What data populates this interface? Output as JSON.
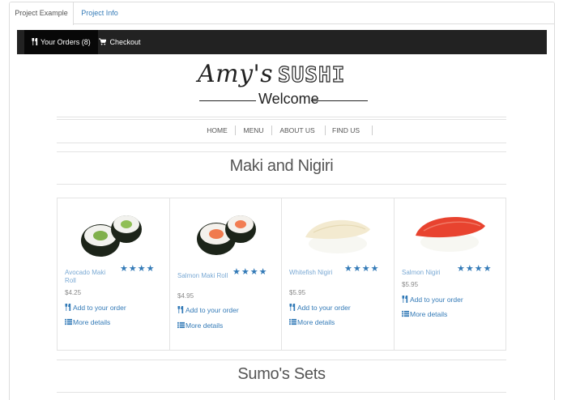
{
  "tabs": [
    {
      "label": "Project Example"
    },
    {
      "label": "Project Info"
    }
  ],
  "navbar": {
    "orders_label": "Your Orders (8)",
    "checkout_label": "Checkout"
  },
  "logo": {
    "name": "Amy's",
    "brand": "SUSHI",
    "tagline": "Welcome"
  },
  "menu": {
    "items": [
      {
        "label": "HOME"
      },
      {
        "label": "MENU"
      },
      {
        "label": "ABOUT US"
      },
      {
        "label": "FIND US"
      }
    ]
  },
  "sections": [
    {
      "title": "Maki and Nigiri"
    },
    {
      "title": "Sumo's Sets"
    }
  ],
  "products": [
    {
      "name": "Avocado Maki Roll",
      "price": "$4.25",
      "stars": "★★★★",
      "add_label": "Add to your order",
      "details_label": "More details"
    },
    {
      "name": "Salmon Maki Roll",
      "price": "$4.95",
      "stars": "★★★★",
      "add_label": "Add to your order",
      "details_label": "More details"
    },
    {
      "name": "Whitefish Nigiri",
      "price": "$5.95",
      "stars": "★★★★",
      "add_label": "Add to your order",
      "details_label": "More details"
    },
    {
      "name": "Salmon Nigiri",
      "price": "$5.95",
      "stars": "★★★★",
      "add_label": "Add to your order",
      "details_label": "More details"
    }
  ],
  "colors": {
    "navbar": "#222222",
    "link": "#337ab7",
    "rule": "#e3e3e3"
  }
}
